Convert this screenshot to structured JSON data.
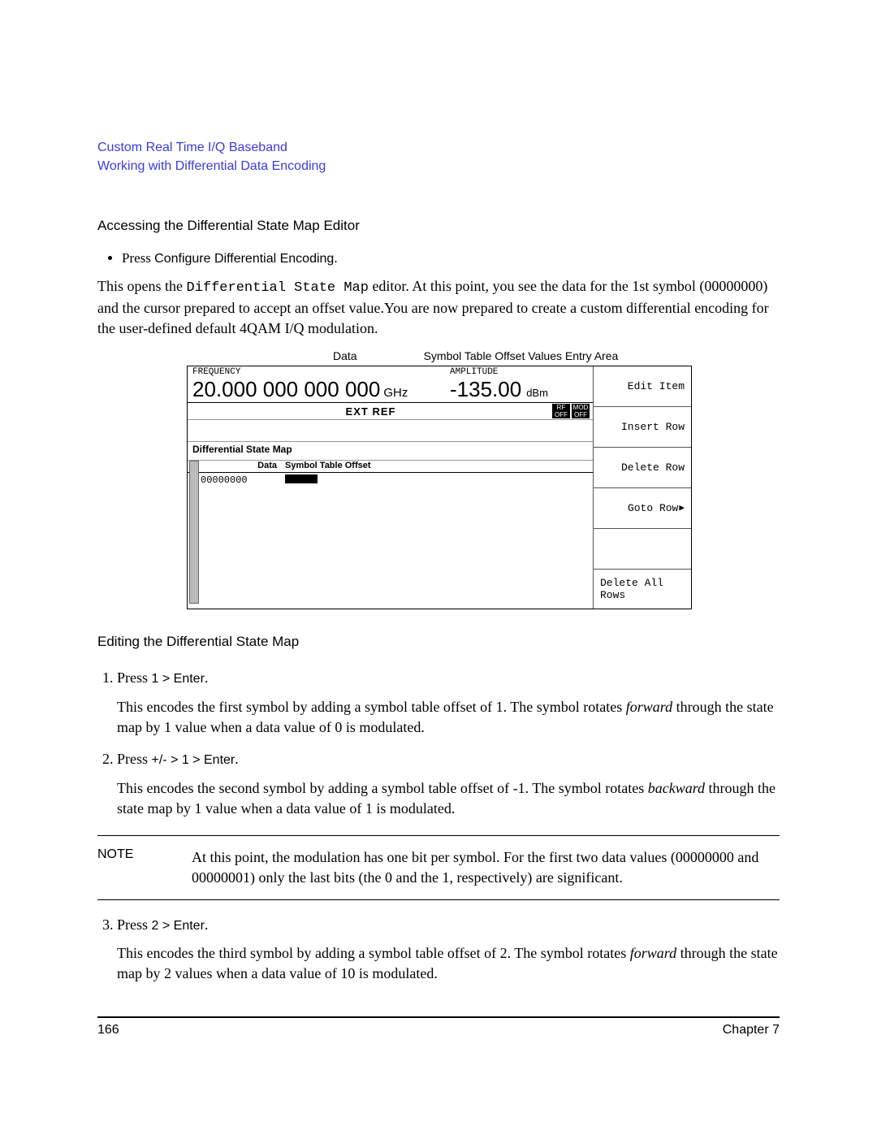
{
  "header": {
    "line1": "Custom Real Time I/Q Baseband",
    "line2": "Working with Differential Data Encoding"
  },
  "section1": {
    "title": "Accessing the Differential State Map Editor",
    "bullet_prefix": "Press ",
    "bullet_ui": "Configure Differential Encoding",
    "bullet_suffix": ".",
    "para_a": "This opens the ",
    "para_mono": "Differential State Map",
    "para_b": " editor. At this point, you see the data for the 1st symbol (00000000) and the cursor prepared to accept an offset value.You are now prepared to create a custom differential encoding for the user-defined default 4QAM I/Q modulation."
  },
  "fig": {
    "label_data": "Data",
    "label_sym": "Symbol Table Offset Values Entry Area",
    "freq_label": "FREQUENCY",
    "freq_value": "20.000 000 000 000",
    "freq_unit": "GHz",
    "amp_label": "AMPLITUDE",
    "amp_value": "-135.00",
    "amp_unit": "dBm",
    "ext_ref": "EXT REF",
    "ind1": "RF\nOFF",
    "ind2": "MOD\nOFF",
    "title": "Differential State Map",
    "col_data": "Data",
    "col_off": "Symbol Table Offset",
    "row1_data": "00000000",
    "softkeys": [
      "Edit Item",
      "Insert Row",
      "Delete Row",
      "Goto Row",
      "",
      "Delete All Rows"
    ]
  },
  "section2": {
    "title": "Editing the Differential State Map",
    "step1_a": "Press ",
    "step1_ui": "1 > Enter",
    "step1_b": ".",
    "step1_body_a": "This encodes the first symbol by adding a symbol table offset of 1. The symbol rotates ",
    "step1_em": "forward",
    "step1_body_b": " through the state map by 1 value when a data value of 0 is modulated.",
    "step2_a": "Press ",
    "step2_ui": "+/- > 1 > Enter",
    "step2_b": ".",
    "step2_body_a": "This encodes the second symbol by adding a symbol table offset of -1. The symbol rotates ",
    "step2_em": "backward",
    "step2_body_b": " through the state map by 1 value when a data value of 1 is modulated.",
    "note_label": "NOTE",
    "note_text": "At this point, the modulation has one bit per symbol. For the first two data values (00000000 and 00000001) only the last bits (the 0 and the 1, respectively) are significant.",
    "step3_a": "Press ",
    "step3_ui": "2 > Enter",
    "step3_b": ".",
    "step3_body_a": "This encodes the third symbol by adding a symbol table offset of 2. The symbol rotates ",
    "step3_em": "forward",
    "step3_body_b": " through the state map by 2 values when a data value of 10 is modulated."
  },
  "footer": {
    "page": "166",
    "chapter": "Chapter 7"
  }
}
